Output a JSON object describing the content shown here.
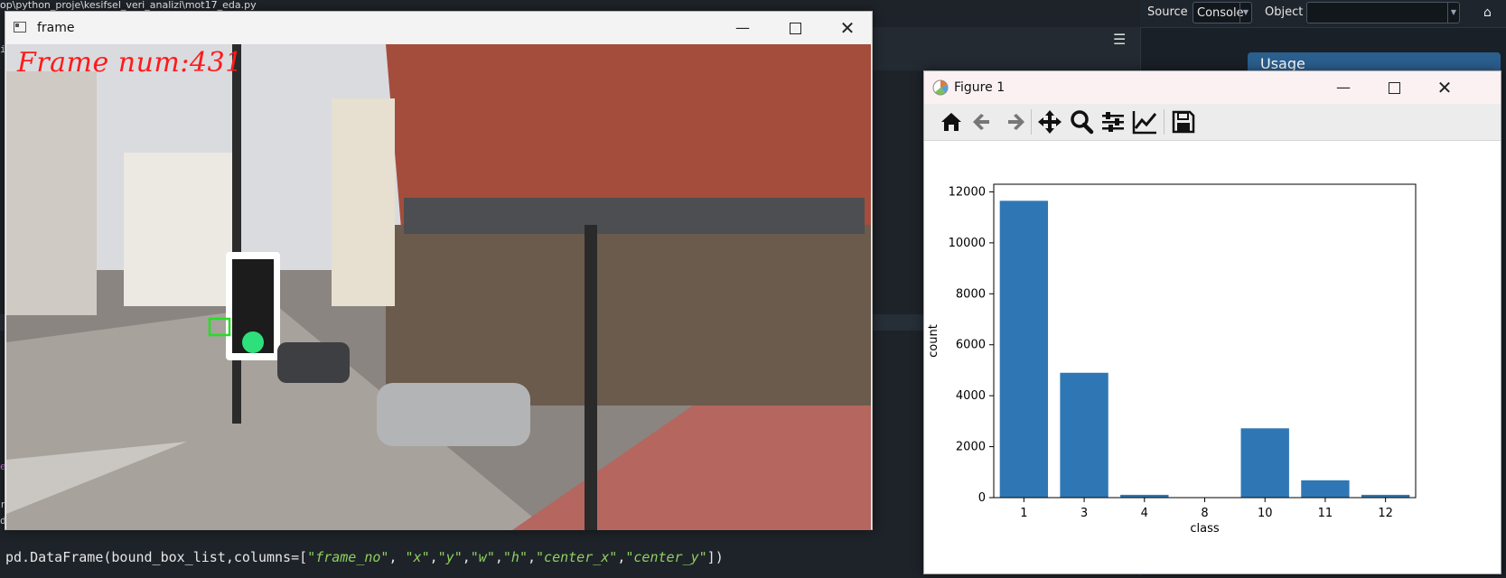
{
  "ide": {
    "path_text": "op\\python_proje\\kesifsel_veri_analizi\\mot17_eda.py",
    "toolbar": {
      "source_label": "Source",
      "source_value": "Console",
      "object_label": "Object",
      "object_value": ""
    },
    "usage_title": "Usage",
    "code_parts": {
      "prefix": "pd.DataFrame(bound_box_list,columns=[",
      "s1": "\"frame_no\"",
      "sep1": ", ",
      "s2": "\"x\"",
      "c2": ",",
      "s3": "\"y\"",
      "c3": ",",
      "s4": "\"w\"",
      "c4": ",",
      "s5": "\"h\"",
      "c5": ",",
      "s6": "\"center_x\"",
      "c6": ",",
      "s7": "\"center_y\"",
      "suffix": "])"
    },
    "gutter": [
      "i",
      "e",
      "r",
      "d"
    ]
  },
  "frame_window": {
    "title": "frame",
    "overlay_text": "Frame num:431",
    "colors": {
      "overlay": "#ff1a1a",
      "detection_box": "#22e022"
    }
  },
  "figure_window": {
    "title": "Figure 1",
    "toolbar": [
      "home-icon",
      "back-arrow-icon",
      "forward-arrow-icon",
      "pan-icon",
      "zoom-icon",
      "subplots-icon",
      "axes-edit-icon",
      "save-icon"
    ]
  },
  "chart_data": {
    "type": "bar",
    "categories": [
      "1",
      "3",
      "4",
      "8",
      "10",
      "11",
      "12"
    ],
    "values": [
      11650,
      4900,
      110,
      0,
      2720,
      680,
      110
    ],
    "xlabel": "class",
    "ylabel": "count",
    "ylim": [
      0,
      12300
    ],
    "yticks": [
      0,
      2000,
      4000,
      6000,
      8000,
      10000,
      12000
    ],
    "bar_color": "#2f77b4",
    "grid": false
  }
}
